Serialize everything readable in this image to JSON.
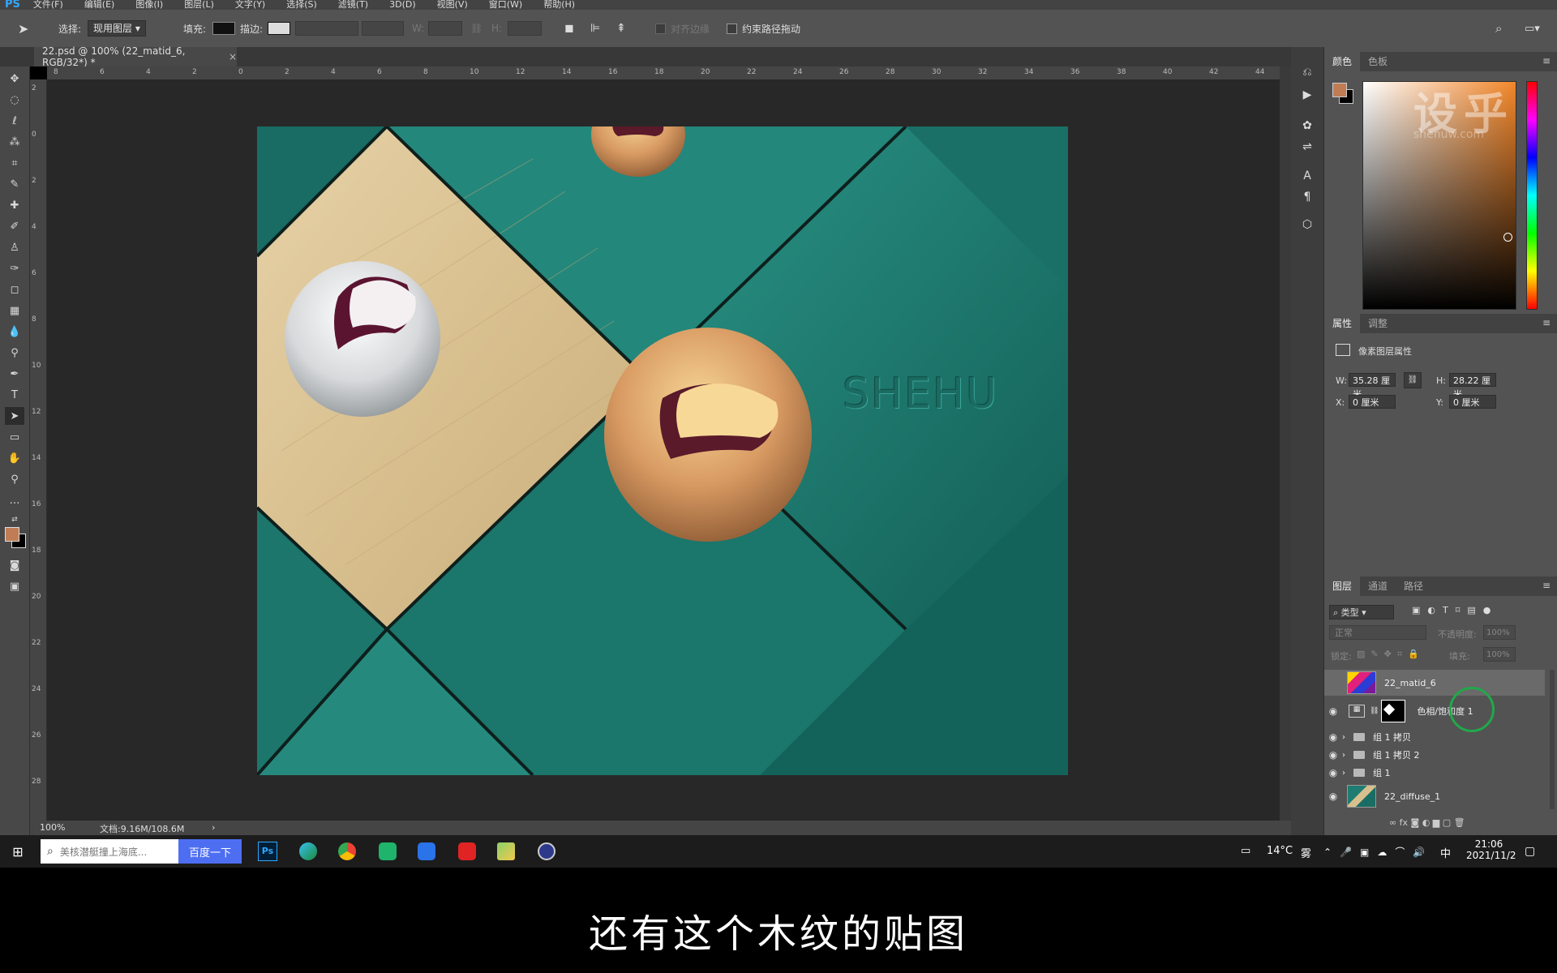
{
  "app": {
    "logo": "PS"
  },
  "menu": [
    "文件(F)",
    "编辑(E)",
    "图像(I)",
    "图层(L)",
    "文字(Y)",
    "选择(S)",
    "滤镜(T)",
    "3D(D)",
    "视图(V)",
    "窗口(W)",
    "帮助(H)"
  ],
  "options": {
    "select_label": "选择:",
    "select_value": "现用图层",
    "fill_label": "填充:",
    "stroke_label": "描边:",
    "w_label": "W:",
    "h_label": "H:",
    "align_edges": "对齐边缘",
    "constrain_path": "约束路径拖动"
  },
  "document": {
    "tab_title": "22.psd @ 100% (22_matid_6, RGB/32*) *",
    "close": "×",
    "canvas_text": "SHEHU"
  },
  "ruler_top": [
    "8",
    "6",
    "4",
    "2",
    "0",
    "2",
    "4",
    "6",
    "8",
    "10",
    "12",
    "14",
    "16",
    "18",
    "20",
    "22",
    "24",
    "26",
    "28",
    "30",
    "32",
    "34",
    "36",
    "38",
    "40",
    "42",
    "44"
  ],
  "ruler_left": [
    "2",
    "0",
    "2",
    "4",
    "6",
    "8",
    "10",
    "12",
    "14",
    "16",
    "18",
    "20",
    "22",
    "24",
    "26",
    "28"
  ],
  "status": {
    "zoom": "100%",
    "doc": "文档:9.16M/108.6M",
    "arrow": "›"
  },
  "tools": [
    "✥",
    "◌",
    "ℓ",
    "⁂",
    "⌗",
    "✎",
    "✚",
    "✐",
    "♙",
    "✑",
    "◻",
    "▦",
    "💧",
    "⚲",
    "✒",
    "T",
    "➤",
    "▭",
    "✋",
    "⚲",
    "…"
  ],
  "color_panel": {
    "tabs": [
      "颜色",
      "色板"
    ],
    "watermark": "设乎",
    "watermark_url": "shenuw.com"
  },
  "properties_panel": {
    "tabs": [
      "属性",
      "调整"
    ],
    "title": "像素图层属性",
    "w_label": "W:",
    "w_value": "35.28 厘米",
    "h_label": "H:",
    "h_value": "28.22 厘米",
    "x_label": "X:",
    "x_value": "0 厘米",
    "y_label": "Y:",
    "y_value": "0 厘米"
  },
  "layers_panel": {
    "tabs": [
      "图层",
      "通道",
      "路径"
    ],
    "filter_kind": "类型",
    "blend_mode": "正常",
    "opacity_label": "不透明度:",
    "opacity_value": "100%",
    "lock_label": "锁定:",
    "fill_label": "填充:",
    "fill_value": "100%",
    "layers": [
      {
        "name": "22_matid_6"
      },
      {
        "name": "色相/饱和度 1"
      },
      {
        "name": "组 1 拷贝"
      },
      {
        "name": "组 1 拷贝 2"
      },
      {
        "name": "组 1"
      },
      {
        "name": "22_diffuse_1"
      }
    ],
    "footer_icons": "∞  fx  ◙  ◐  ▆  ▢  🗑"
  },
  "taskbar": {
    "search_placeholder": "美核潜艇撞上海底...",
    "search_button": "百度一下",
    "temperature": "14°C",
    "weather": "雾",
    "ime": "中",
    "time": "21:06",
    "date": "2021/11/2"
  },
  "subtitle": "还有这个木纹的贴图",
  "colors": {
    "foreground": "#c07d55",
    "background": "#000000",
    "teal": "#1f7c72",
    "accent": "#31a8ff"
  }
}
